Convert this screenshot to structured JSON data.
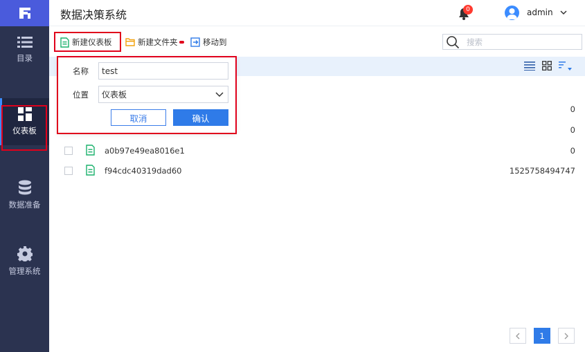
{
  "app": {
    "title": "数据决策系统"
  },
  "header": {
    "notification_count": "0",
    "username": "admin"
  },
  "sidebar": {
    "items": [
      {
        "label": "目录",
        "icon": "list-icon"
      },
      {
        "label": "仪表板",
        "icon": "dashboard-icon",
        "active": true
      },
      {
        "label": "数据准备",
        "icon": "database-icon"
      },
      {
        "label": "管理系统",
        "icon": "gear-icon"
      }
    ]
  },
  "toolbar": {
    "new_dashboard": "新建仪表板",
    "new_folder": "新建文件夹",
    "move_to": "移动到",
    "search_placeholder": "搜索"
  },
  "popup": {
    "name_label": "名称",
    "name_value": "test",
    "location_label": "位置",
    "location_value": "仪表板",
    "cancel": "取消",
    "confirm": "确认"
  },
  "list": {
    "rows": [
      {
        "name": "",
        "value": "0"
      },
      {
        "name": "",
        "value": "0"
      },
      {
        "name": "a0b97e49ea8016e1",
        "value": "0"
      },
      {
        "name": "f94cdc40319dad60",
        "value": "1525758494747"
      }
    ]
  },
  "pagination": {
    "current": "1"
  },
  "colors": {
    "sidebar": "#2b3350",
    "brand": "#4a5bdc",
    "primary": "#2f7be8",
    "highlight": "#e0001b"
  }
}
